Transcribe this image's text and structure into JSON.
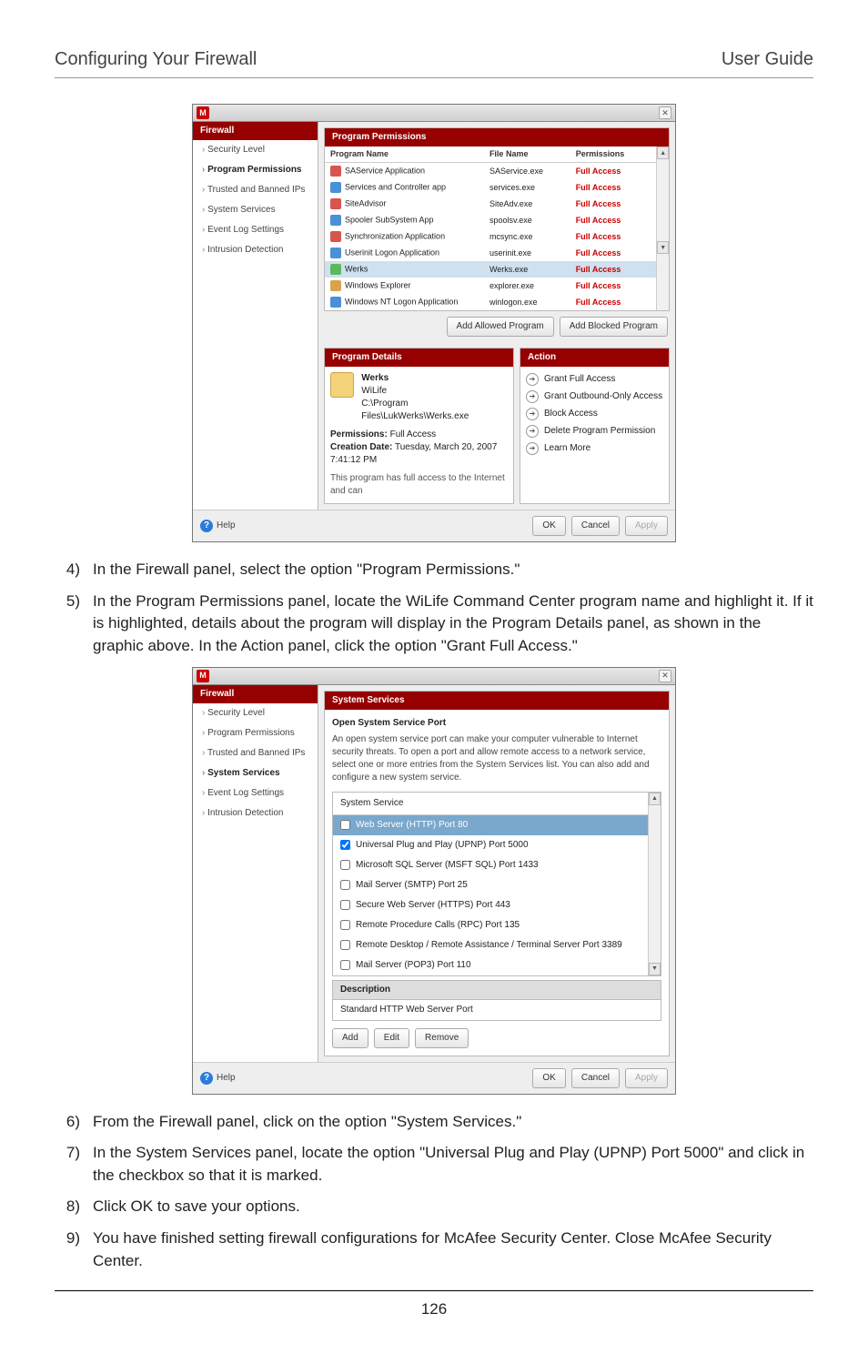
{
  "header": {
    "left": "Configuring Your Firewall",
    "right": "User Guide"
  },
  "fig1": {
    "sidebar": {
      "title": "Firewall",
      "items": [
        "Security Level",
        "Program Permissions",
        "Trusted and Banned IPs",
        "System Services",
        "Event Log Settings",
        "Intrusion Detection"
      ],
      "active": 1
    },
    "panel_title": "Program Permissions",
    "columns": [
      "Program Name",
      "File Name",
      "Permissions"
    ],
    "rows": [
      {
        "name": "SAService Application",
        "file": "SAService.exe",
        "perm": "Full Access",
        "ico": "r"
      },
      {
        "name": "Services and Controller app",
        "file": "services.exe",
        "perm": "Full Access",
        "ico": "b"
      },
      {
        "name": "SiteAdvisor",
        "file": "SiteAdv.exe",
        "perm": "Full Access",
        "ico": "r"
      },
      {
        "name": "Spooler SubSystem App",
        "file": "spoolsv.exe",
        "perm": "Full Access",
        "ico": "b"
      },
      {
        "name": "Synchronization Application",
        "file": "mcsync.exe",
        "perm": "Full Access",
        "ico": "r"
      },
      {
        "name": "Userinit Logon Application",
        "file": "userinit.exe",
        "perm": "Full Access",
        "ico": "b"
      },
      {
        "name": "Werks",
        "file": "Werks.exe",
        "perm": "Full Access",
        "ico": "g",
        "sel": true
      },
      {
        "name": "Windows Explorer",
        "file": "explorer.exe",
        "perm": "Full Access",
        "ico": "y"
      },
      {
        "name": "Windows NT Logon Application",
        "file": "winlogon.exe",
        "perm": "Full Access",
        "ico": "b"
      }
    ],
    "add_allowed": "Add Allowed Program",
    "add_blocked": "Add Blocked Program",
    "detail_title": "Program Details",
    "detail": {
      "name": "Werks",
      "vendor": "WiLife",
      "path": "C:\\Program Files\\LukWerks\\Werks.exe",
      "permissions_label": "Permissions:",
      "permissions": "Full Access",
      "creation_label": "Creation Date:",
      "creation": "Tuesday, March 20, 2007 7:41:12 PM",
      "note": "This program has full access to the Internet and can"
    },
    "action_title": "Action",
    "actions": [
      "Grant Full Access",
      "Grant Outbound-Only Access",
      "Block Access",
      "Delete Program Permission",
      "Learn More"
    ],
    "ok": "OK",
    "cancel": "Cancel",
    "apply": "Apply",
    "help": "Help"
  },
  "step4": "In the Firewall panel, select the option \"Program Permissions.\"",
  "step5": "In the Program Permissions panel, locate the WiLife Command Center program name and highlight it. If it is highlighted, details about the program will display in the Program Details panel, as shown in the graphic above.  In the Action panel, click the option \"Grant Full Access.\"",
  "fig2": {
    "sidebar": {
      "title": "Firewall",
      "items": [
        "Security Level",
        "Program Permissions",
        "Trusted and Banned IPs",
        "System Services",
        "Event Log Settings",
        "Intrusion Detection"
      ],
      "active": 3
    },
    "panel_title": "System Services",
    "subtitle": "Open System Service Port",
    "info": "An open system service port can make your computer vulnerable to Internet security threats. To open a port and allow remote access to a network service, select one or more entries from the System Services list. You can also add and configure a new system service.",
    "list_header": "System Service",
    "services": [
      {
        "label": "Web Server (HTTP) Port 80",
        "checked": false,
        "sel": true
      },
      {
        "label": "Universal Plug and Play (UPNP) Port 5000",
        "checked": true
      },
      {
        "label": "Microsoft SQL Server (MSFT SQL) Port 1433",
        "checked": false
      },
      {
        "label": "Mail Server (SMTP) Port 25",
        "checked": false
      },
      {
        "label": "Secure Web Server (HTTPS) Port 443",
        "checked": false
      },
      {
        "label": "Remote Procedure Calls (RPC) Port 135",
        "checked": false
      },
      {
        "label": "Remote Desktop / Remote Assistance / Terminal Server Port 3389",
        "checked": false
      },
      {
        "label": "Mail Server (POP3) Port 110",
        "checked": false
      }
    ],
    "desc_title": "Description",
    "desc_text": "Standard HTTP Web Server Port",
    "add": "Add",
    "edit": "Edit",
    "remove": "Remove",
    "ok": "OK",
    "cancel": "Cancel",
    "apply": "Apply",
    "help": "Help"
  },
  "step6": "From the Firewall panel, click on the option \"System Services.\"",
  "step7": "In the System Services panel, locate the option \"Universal Plug and Play (UPNP) Port 5000\" and click in the checkbox so that it is marked.",
  "step8": "Click OK to save your options.",
  "step9": "You have finished setting firewall configurations for McAfee Security Center. Close McAfee Security Center.",
  "page_number": "126"
}
